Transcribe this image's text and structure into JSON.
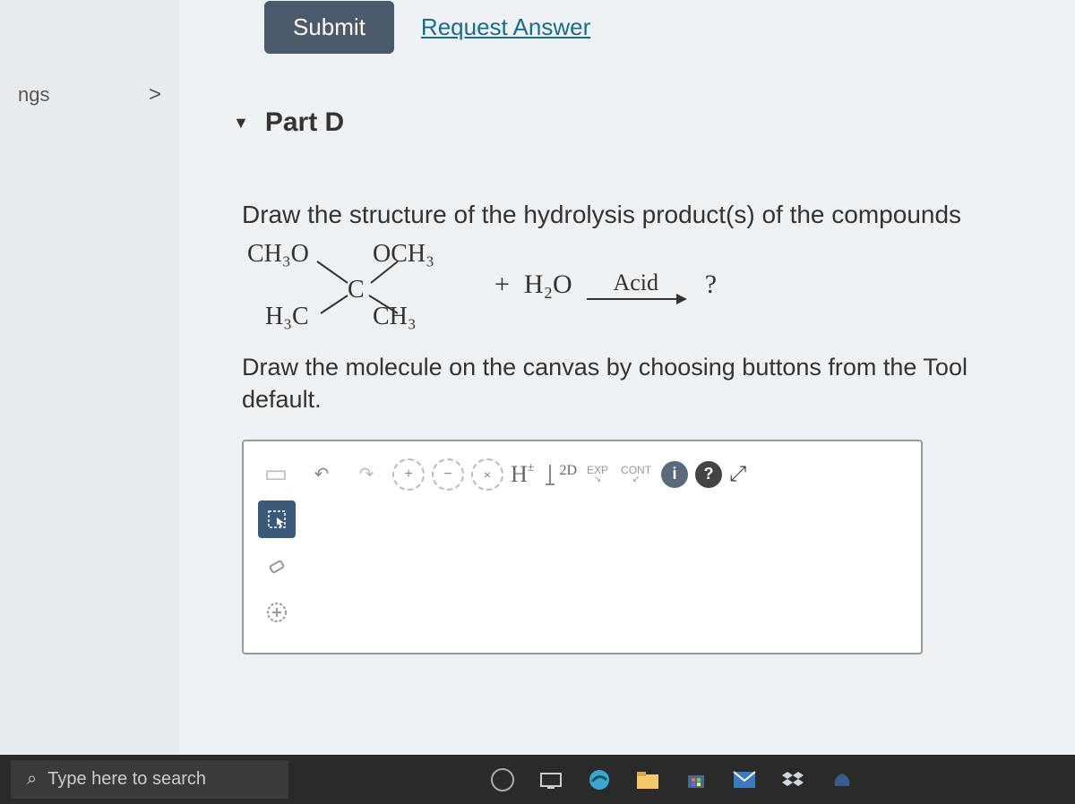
{
  "sidebar": {
    "item_label": "ngs",
    "chevron": ">"
  },
  "top": {
    "submit_label": "Submit",
    "request_label": "Request Answer"
  },
  "part": {
    "toggle": "▼",
    "title": "Part D"
  },
  "question": {
    "prompt": "Draw the structure of the hydrolysis product(s) of the compounds",
    "substituents": {
      "ch3o_left": "CH₃O",
      "och3_right": "OCH₃",
      "h3c_left": "H₃C",
      "ch3_right": "CH₃",
      "center": "C"
    },
    "plus": "+",
    "water": "H₂O",
    "arrow_label": "Acid",
    "product": "?",
    "instruction": "Draw the molecule on the canvas by choosing buttons from the Tool default."
  },
  "canvas_toolbar": {
    "undo": "↶",
    "redo": "↷",
    "zoom_in": "⊕",
    "zoom_out": "⊖",
    "best_fit": "⊗",
    "h_label": "H",
    "h_plusminus": "±",
    "twod_label": "2D",
    "exp_label": "EXP",
    "cont_label": "CONT",
    "info": "i",
    "help": "?",
    "expand": "⤢"
  },
  "left_tools": {
    "select": "⬚",
    "eraser": "◇",
    "add": "⊕"
  },
  "taskbar": {
    "search_placeholder": "Type here to search",
    "search_icon": "⌕"
  }
}
